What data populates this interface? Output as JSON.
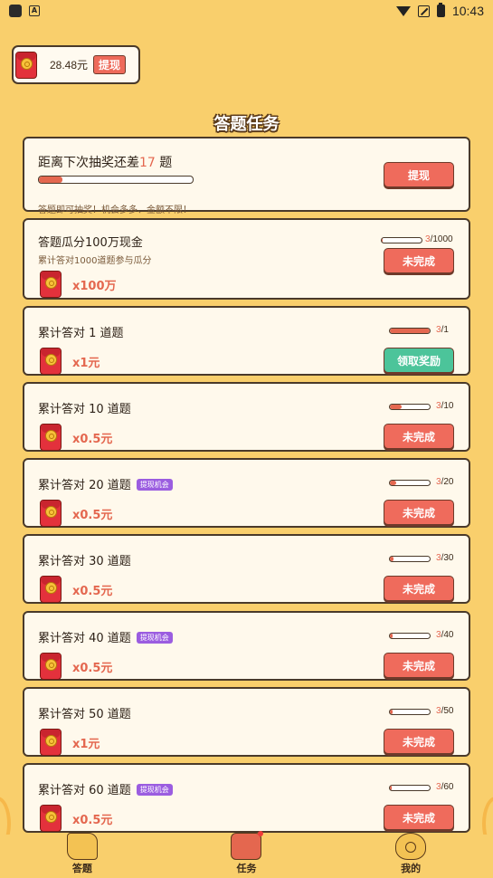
{
  "status_bar": {
    "time": "10:43"
  },
  "wallet": {
    "amount": "28.48元",
    "withdraw_label": "提现"
  },
  "section_title": "答题任务",
  "lottery": {
    "title_prefix": "距离下次抽奖还差",
    "count": "17",
    "title_suffix": " 题",
    "progress": 0.15,
    "note": "答题即可抽奖！机会多多、金额不限！",
    "button": "提现"
  },
  "million": {
    "title": "答题瓜分100万现金",
    "subtitle": "累计答对1000道题参与瓜分",
    "progress_cur": "3",
    "progress_total": "/1000",
    "progress": 0.003,
    "reward": "x100万",
    "button": "未完成"
  },
  "tasks": [
    {
      "title": "累计答对 1 道题",
      "badge": "",
      "progress_cur": "3",
      "progress_total": "/1",
      "progress": 1.0,
      "reward": "x1元",
      "button": "领取奖励",
      "claimable": true
    },
    {
      "title": "累计答对 10 道题",
      "badge": "",
      "progress_cur": "3",
      "progress_total": "/10",
      "progress": 0.3,
      "reward": "x0.5元",
      "button": "未完成",
      "claimable": false
    },
    {
      "title": "累计答对 20 道题",
      "badge": "提现机会",
      "progress_cur": "3",
      "progress_total": "/20",
      "progress": 0.15,
      "reward": "x0.5元",
      "button": "未完成",
      "claimable": false
    },
    {
      "title": "累计答对 30 道题",
      "badge": "",
      "progress_cur": "3",
      "progress_total": "/30",
      "progress": 0.1,
      "reward": "x0.5元",
      "button": "未完成",
      "claimable": false
    },
    {
      "title": "累计答对 40 道题",
      "badge": "提现机会",
      "progress_cur": "3",
      "progress_total": "/40",
      "progress": 0.075,
      "reward": "x0.5元",
      "button": "未完成",
      "claimable": false
    },
    {
      "title": "累计答对 50 道题",
      "badge": "",
      "progress_cur": "3",
      "progress_total": "/50",
      "progress": 0.06,
      "reward": "x1元",
      "button": "未完成",
      "claimable": false
    },
    {
      "title": "累计答对 60 道题",
      "badge": "提现机会",
      "progress_cur": "3",
      "progress_total": "/60",
      "progress": 0.05,
      "reward": "x0.5元",
      "button": "未完成",
      "claimable": false
    }
  ],
  "nav": [
    {
      "label": "答题",
      "icon": "quiz-scroll-icon"
    },
    {
      "label": "任务",
      "icon": "task-scroll-icon"
    },
    {
      "label": "我的",
      "icon": "profile-gong-icon"
    }
  ],
  "colors": {
    "background": "#f9cf6c",
    "accent": "#ef6b5c",
    "claim": "#4cc49a",
    "badge": "#9b5de0"
  }
}
